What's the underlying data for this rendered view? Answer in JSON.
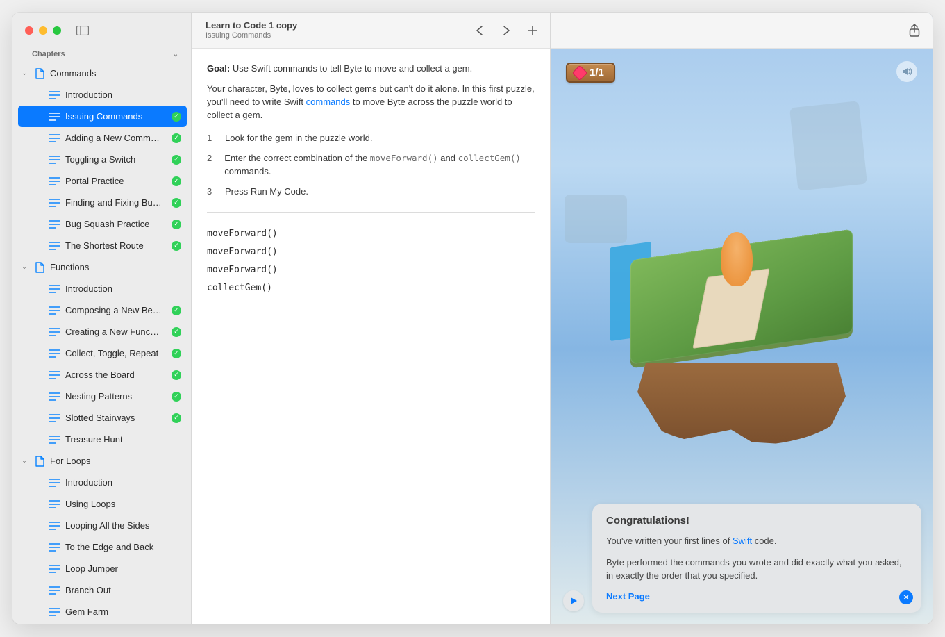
{
  "window": {
    "sidebar_header": "Chapters"
  },
  "header": {
    "title": "Learn to Code 1 copy",
    "subtitle": "Issuing Commands"
  },
  "sidebar": {
    "sections": [
      {
        "title": "Commands",
        "items": [
          {
            "label": "Introduction",
            "done": false,
            "active": false
          },
          {
            "label": "Issuing Commands",
            "done": true,
            "active": true
          },
          {
            "label": "Adding a New Comm…",
            "done": true,
            "active": false
          },
          {
            "label": "Toggling a Switch",
            "done": true,
            "active": false
          },
          {
            "label": "Portal Practice",
            "done": true,
            "active": false
          },
          {
            "label": "Finding and Fixing Bu…",
            "done": true,
            "active": false
          },
          {
            "label": "Bug Squash Practice",
            "done": true,
            "active": false
          },
          {
            "label": "The Shortest Route",
            "done": true,
            "active": false
          }
        ]
      },
      {
        "title": "Functions",
        "items": [
          {
            "label": "Introduction",
            "done": false,
            "active": false
          },
          {
            "label": "Composing a New Be…",
            "done": true,
            "active": false
          },
          {
            "label": "Creating a New Func…",
            "done": true,
            "active": false
          },
          {
            "label": "Collect, Toggle, Repeat",
            "done": true,
            "active": false
          },
          {
            "label": "Across the Board",
            "done": true,
            "active": false
          },
          {
            "label": "Nesting Patterns",
            "done": true,
            "active": false
          },
          {
            "label": "Slotted Stairways",
            "done": true,
            "active": false
          },
          {
            "label": "Treasure Hunt",
            "done": false,
            "active": false
          }
        ]
      },
      {
        "title": "For Loops",
        "items": [
          {
            "label": "Introduction",
            "done": false,
            "active": false
          },
          {
            "label": "Using Loops",
            "done": false,
            "active": false
          },
          {
            "label": "Looping All the Sides",
            "done": false,
            "active": false
          },
          {
            "label": "To the Edge and Back",
            "done": false,
            "active": false
          },
          {
            "label": "Loop Jumper",
            "done": false,
            "active": false
          },
          {
            "label": "Branch Out",
            "done": false,
            "active": false
          },
          {
            "label": "Gem Farm",
            "done": false,
            "active": false
          }
        ]
      }
    ]
  },
  "lesson": {
    "goal_label": "Goal:",
    "goal_text": " Use Swift commands to tell Byte to move and collect a gem.",
    "intro_pre": "Your character, Byte, loves to collect gems but can't do it alone. In this first puzzle, you'll need to write Swift ",
    "intro_link": "commands",
    "intro_post": " to move Byte across the puzzle world to collect a gem.",
    "steps": [
      {
        "n": "1",
        "text_pre": "Look for the gem in the puzzle world.",
        "code1": "",
        "mid": "",
        "code2": "",
        "text_post": ""
      },
      {
        "n": "2",
        "text_pre": "Enter the correct combination of the ",
        "code1": "moveForward()",
        "mid": " and ",
        "code2": "collectGem()",
        "text_post": " commands."
      },
      {
        "n": "3",
        "text_pre": "Press Run My Code.",
        "code1": "",
        "mid": "",
        "code2": "",
        "text_post": ""
      }
    ],
    "code_lines": [
      "moveForward()",
      "moveForward()",
      "moveForward()",
      "collectGem()"
    ]
  },
  "game": {
    "gem_counter": "1/1",
    "popup": {
      "title": "Congratulations!",
      "line1_pre": "You've written your first lines of ",
      "line1_link": "Swift",
      "line1_post": " code.",
      "line2": "Byte performed the commands you wrote and did exactly what you asked, in exactly the order that you specified.",
      "next": "Next Page"
    }
  }
}
